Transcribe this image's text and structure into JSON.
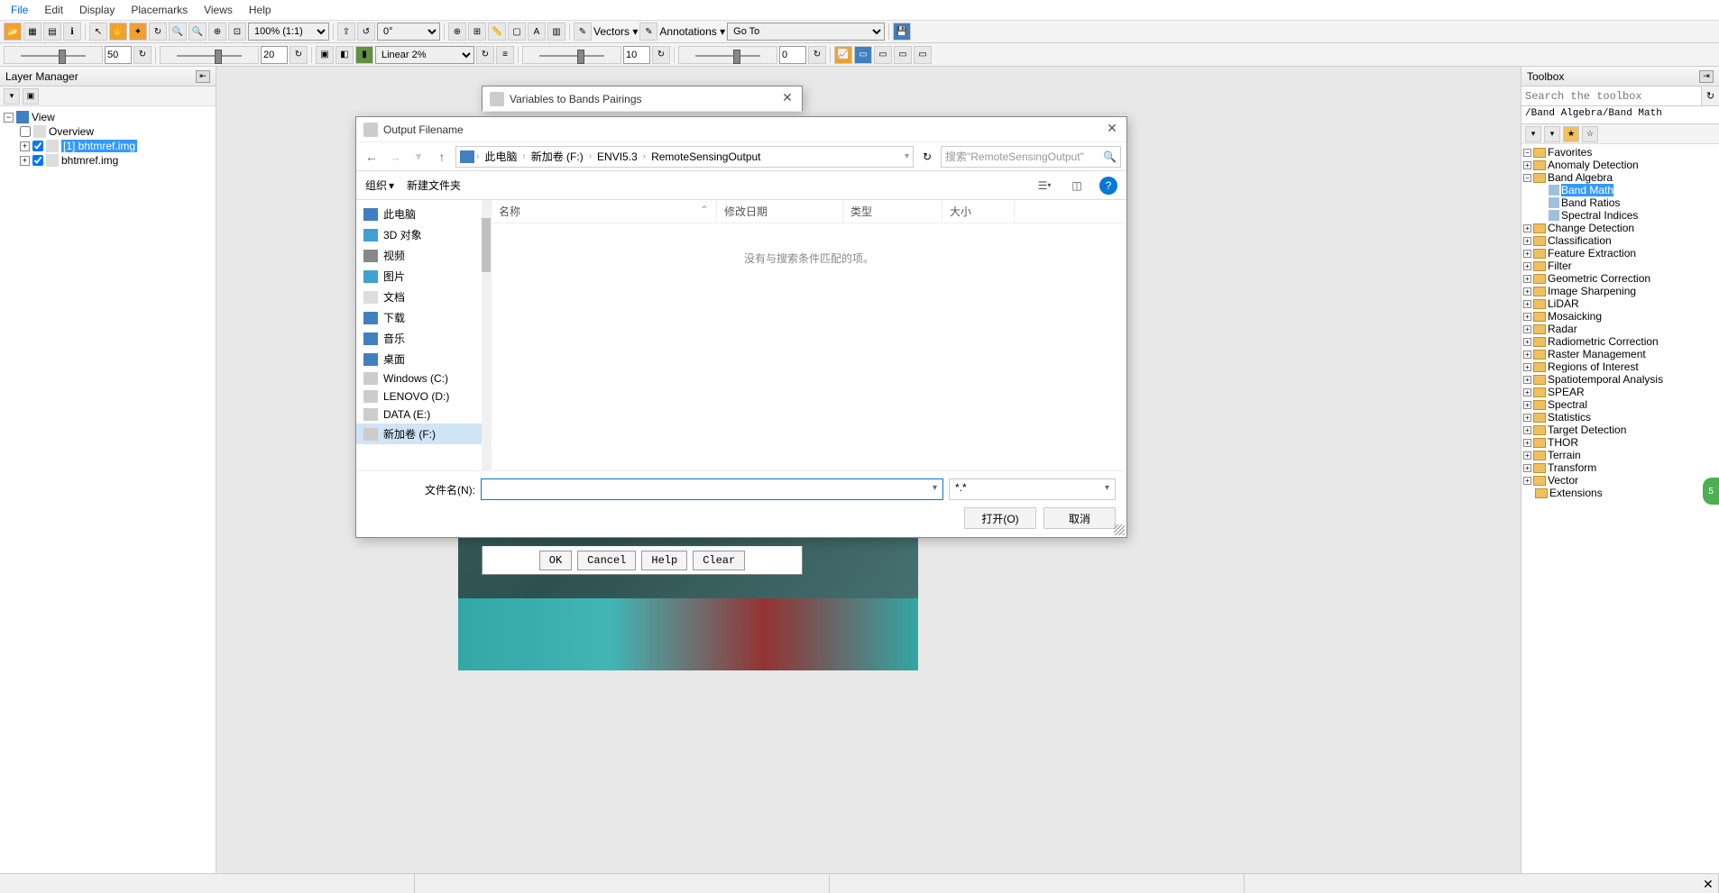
{
  "menu": {
    "file": "File",
    "edit": "Edit",
    "display": "Display",
    "placemarks": "Placemarks",
    "views": "Views",
    "help": "Help"
  },
  "toolbar": {
    "zoom": "100% (1:1)",
    "rotate": "0°",
    "vectors": "Vectors",
    "annotations": "Annotations",
    "goto": "Go To",
    "val1": "50",
    "val2": "20",
    "stretch": "Linear 2%",
    "val3": "10",
    "val4": "0"
  },
  "layer_panel": {
    "title": "Layer Manager",
    "view": "View",
    "overview": "Overview",
    "item1": "[1] bhtmref.img",
    "item2": "bhtmref.img"
  },
  "toolbox": {
    "title": "Toolbox",
    "search_placeholder": "Search the toolbox",
    "path": "/Band Algebra/Band Math",
    "items": {
      "favorites": "Favorites",
      "anomaly": "Anomaly Detection",
      "band_algebra": "Band Algebra",
      "band_math": "Band Math",
      "band_ratios": "Band Ratios",
      "spectral_indices": "Spectral Indices",
      "change": "Change Detection",
      "classification": "Classification",
      "feature": "Feature Extraction",
      "filter": "Filter",
      "geometric": "Geometric Correction",
      "sharpening": "Image Sharpening",
      "lidar": "LiDAR",
      "mosaicking": "Mosaicking",
      "radar": "Radar",
      "radiometric": "Radiometric Correction",
      "raster": "Raster Management",
      "roi": "Regions of Interest",
      "spatiotemporal": "Spatiotemporal Analysis",
      "spear": "SPEAR",
      "spectral": "Spectral",
      "statistics": "Statistics",
      "target": "Target Detection",
      "thor": "THOR",
      "terrain": "Terrain",
      "transform": "Transform",
      "vector": "Vector",
      "extensions": "Extensions"
    }
  },
  "vars_dialog": {
    "title": "Variables to Bands Pairings",
    "ok": "OK",
    "cancel": "Cancel",
    "help": "Help",
    "clear": "Clear"
  },
  "output_dialog": {
    "title": "Output Filename",
    "bc1": "此电脑",
    "bc2": "新加卷 (F:)",
    "bc3": "ENVI5.3",
    "bc4": "RemoteSensingOutput",
    "search": "搜索\"RemoteSensingOutput\"",
    "organize": "组织",
    "new_folder": "新建文件夹",
    "col_name": "名称",
    "col_date": "修改日期",
    "col_type": "类型",
    "col_size": "大小",
    "empty": "没有与搜索条件匹配的项。",
    "sidebar": {
      "this_pc": "此电脑",
      "objects3d": "3D 对象",
      "videos": "视频",
      "pictures": "图片",
      "documents": "文档",
      "downloads": "下载",
      "music": "音乐",
      "desktop": "桌面",
      "win_c": "Windows (C:)",
      "lenovo_d": "LENOVO (D:)",
      "data_e": "DATA (E:)",
      "new_f": "新加卷 (F:)"
    },
    "filename_label": "文件名(N):",
    "type_filter": "*.*",
    "open": "打开(O)",
    "cancel": "取消"
  },
  "bubble": "5"
}
